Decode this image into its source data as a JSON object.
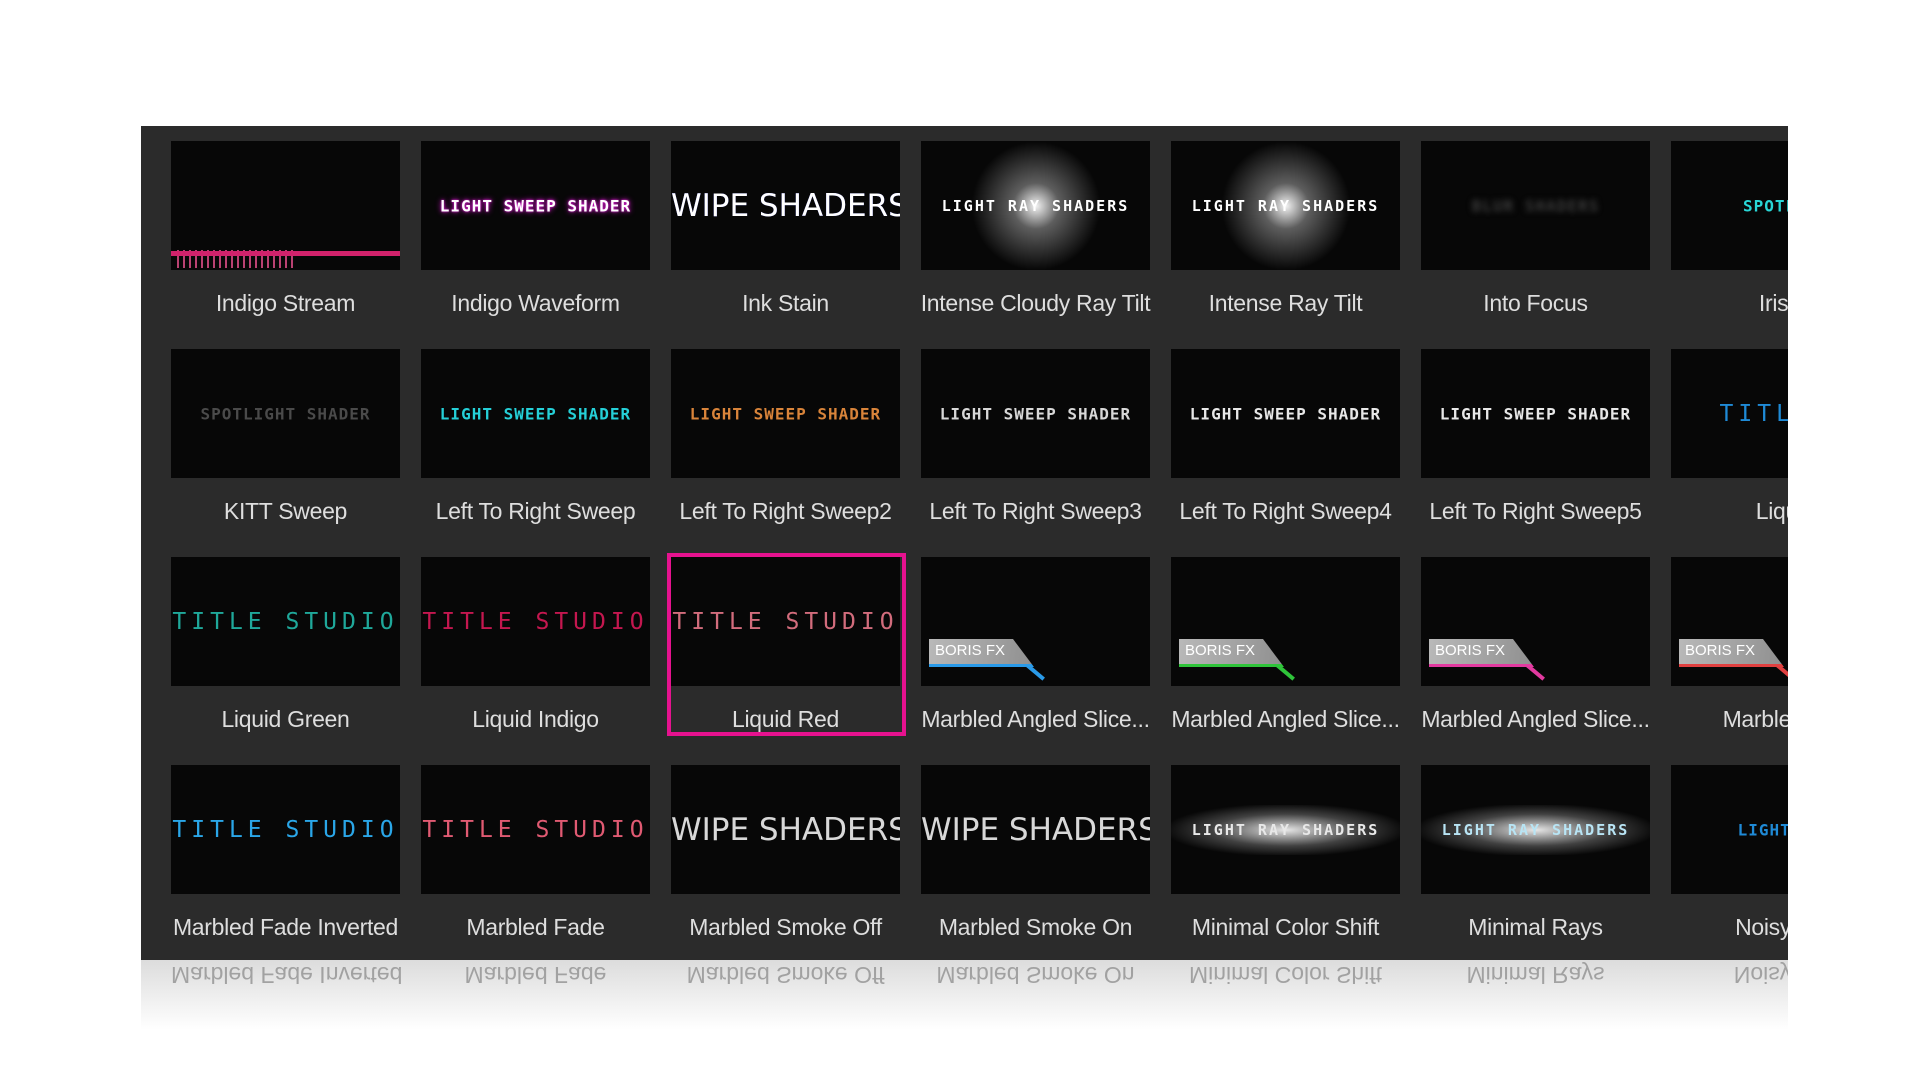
{
  "tiles": [
    {
      "label": "Indigo Stream",
      "thumb": {
        "kind": "stream",
        "text": ""
      }
    },
    {
      "label": "Indigo Waveform",
      "thumb": {
        "kind": "sweep",
        "text": "LIGHT SWEEP SHADER",
        "color": "#ffffff",
        "accent": "#e11cd8"
      }
    },
    {
      "label": "Ink Stain",
      "thumb": {
        "kind": "wipe",
        "text": "WIPE SHADERS",
        "color": "#ffffff",
        "accent": "#2a33ff"
      }
    },
    {
      "label": "Intense Cloudy Ray Tilt",
      "thumb": {
        "kind": "ray",
        "text": "LIGHT RAY SHADERS",
        "color": "#ffffff"
      }
    },
    {
      "label": "Intense Ray Tilt",
      "thumb": {
        "kind": "ray",
        "text": "LIGHT RAY SHADERS",
        "color": "#ffffff"
      }
    },
    {
      "label": "Into Focus",
      "thumb": {
        "kind": "blur",
        "text": "BLUR SHADERS",
        "color": "#2a2a2a"
      }
    },
    {
      "label": "Iris O",
      "thumb": {
        "kind": "sweep",
        "text": "SPOTLIGH",
        "color": "#29d6d6"
      }
    },
    {
      "label": "KITT Sweep",
      "thumb": {
        "kind": "sweep",
        "text": "SPOTLIGHT SHADER",
        "color": "#4a4a4a"
      }
    },
    {
      "label": "Left To Right Sweep",
      "thumb": {
        "kind": "sweep",
        "text": "LIGHT SWEEP SHADER",
        "color": "#25d0d8"
      }
    },
    {
      "label": "Left To Right Sweep2",
      "thumb": {
        "kind": "sweep",
        "text": "LIGHT SWEEP SHADER",
        "color": "#d9843a"
      }
    },
    {
      "label": "Left To Right Sweep3",
      "thumb": {
        "kind": "sweep",
        "text": "LIGHT SWEEP SHADER",
        "color": "#d8d8d8"
      }
    },
    {
      "label": "Left To Right Sweep4",
      "thumb": {
        "kind": "sweep",
        "text": "LIGHT SWEEP SHADER",
        "color": "#e8e8e8"
      }
    },
    {
      "label": "Left To Right Sweep5",
      "thumb": {
        "kind": "sweep",
        "text": "LIGHT SWEEP SHADER",
        "color": "#e8e8e8"
      }
    },
    {
      "label": "Liquid",
      "thumb": {
        "kind": "title",
        "text": "TITLE S",
        "color": "#1f8ad6"
      }
    },
    {
      "label": "Liquid Green",
      "thumb": {
        "kind": "title",
        "text": "TITLE STUDIO",
        "color": "#1fa89a"
      }
    },
    {
      "label": "Liquid Indigo",
      "thumb": {
        "kind": "title",
        "text": "TITLE STUDIO",
        "color": "#c4174f"
      }
    },
    {
      "label": "Liquid Red",
      "thumb": {
        "kind": "title",
        "text": "TITLE STUDIO",
        "color": "#d26c7c"
      },
      "selected": true
    },
    {
      "label": "Marbled Angled Slice...",
      "thumb": {
        "kind": "boris",
        "text": "BORIS FX",
        "accent": "#2a9ae8"
      }
    },
    {
      "label": "Marbled Angled Slice...",
      "thumb": {
        "kind": "boris",
        "text": "BORIS FX",
        "accent": "#2fc43a"
      }
    },
    {
      "label": "Marbled Angled Slice...",
      "thumb": {
        "kind": "boris",
        "text": "BORIS FX",
        "accent": "#e23aa0"
      }
    },
    {
      "label": "Marbled Ang",
      "thumb": {
        "kind": "boris",
        "text": "BORIS FX",
        "accent": "#e04040"
      }
    },
    {
      "label": "Marbled Fade Inverted",
      "thumb": {
        "kind": "title",
        "text": "TITLE STUDIO",
        "color": "#2aa6e8"
      }
    },
    {
      "label": "Marbled Fade",
      "thumb": {
        "kind": "title",
        "text": "TITLE STUDIO",
        "color": "#e05a72"
      }
    },
    {
      "label": "Marbled Smoke Off",
      "thumb": {
        "kind": "wipe",
        "text": "WIPE SHADERS",
        "color": "#d8d8d8"
      }
    },
    {
      "label": "Marbled Smoke On",
      "thumb": {
        "kind": "wipe",
        "text": "WIPE SHADERS",
        "color": "#d8d8d8"
      }
    },
    {
      "label": "Minimal Color Shift",
      "thumb": {
        "kind": "hray",
        "text": "LIGHT RAY SHADERS",
        "color": "#e8e8e8"
      }
    },
    {
      "label": "Minimal Rays",
      "thumb": {
        "kind": "hray",
        "text": "LIGHT RAY SHADERS",
        "color": "#b8e4f4"
      }
    },
    {
      "label": "Noisy Aqu",
      "thumb": {
        "kind": "sweep",
        "text": "LIGHT SWE",
        "color": "#1f8ad6"
      }
    }
  ],
  "reflection": [
    "Marbled Fade Inverted",
    "Marbled Fade",
    "Marbled Smoke Off",
    "Marbled Smoke On",
    "Minimal Color Shift",
    "Minimal Rays",
    "Noisy Aqu"
  ]
}
